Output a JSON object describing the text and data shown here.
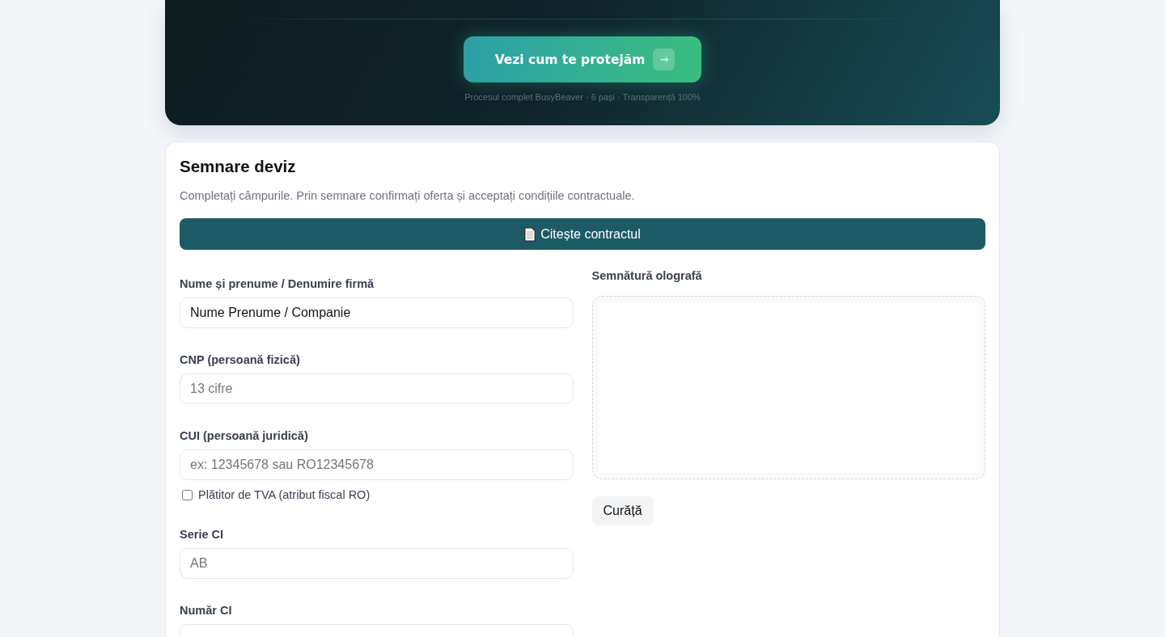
{
  "hero": {
    "cta_button": {
      "label": "Vezi cum te protejăm",
      "arrow": "→"
    },
    "caption": "Procesul complet BusyBeaver · 6 pași · Transparență 100%"
  },
  "form": {
    "title": "Semnare deviz",
    "description": "Completați câmpurile. Prin semnare confirmați oferta și acceptați condițiile contractuale.",
    "contract_button": {
      "label": "Citește contractul"
    },
    "fields": [
      {
        "kind": "text",
        "label": "Nume și prenume / Denumire firmă",
        "value": "Nume Prenume / Companie"
      },
      {
        "kind": "text",
        "label": "CNP (persoană fizică)",
        "placeholder": "13 cifre"
      },
      {
        "kind": "text",
        "label": "CUI (persoană juridică)",
        "placeholder": "ex: 12345678 sau RO12345678"
      },
      {
        "kind": "checkbox",
        "label": "Plătitor de TVA (atribut fiscal RO)",
        "checked": false
      },
      {
        "kind": "text",
        "label": "Serie CI",
        "placeholder": "AB"
      },
      {
        "kind": "text",
        "label": "Număr CI"
      }
    ],
    "signature": {
      "label": "Semnătură olografă",
      "clear_button": "Curăță"
    }
  }
}
